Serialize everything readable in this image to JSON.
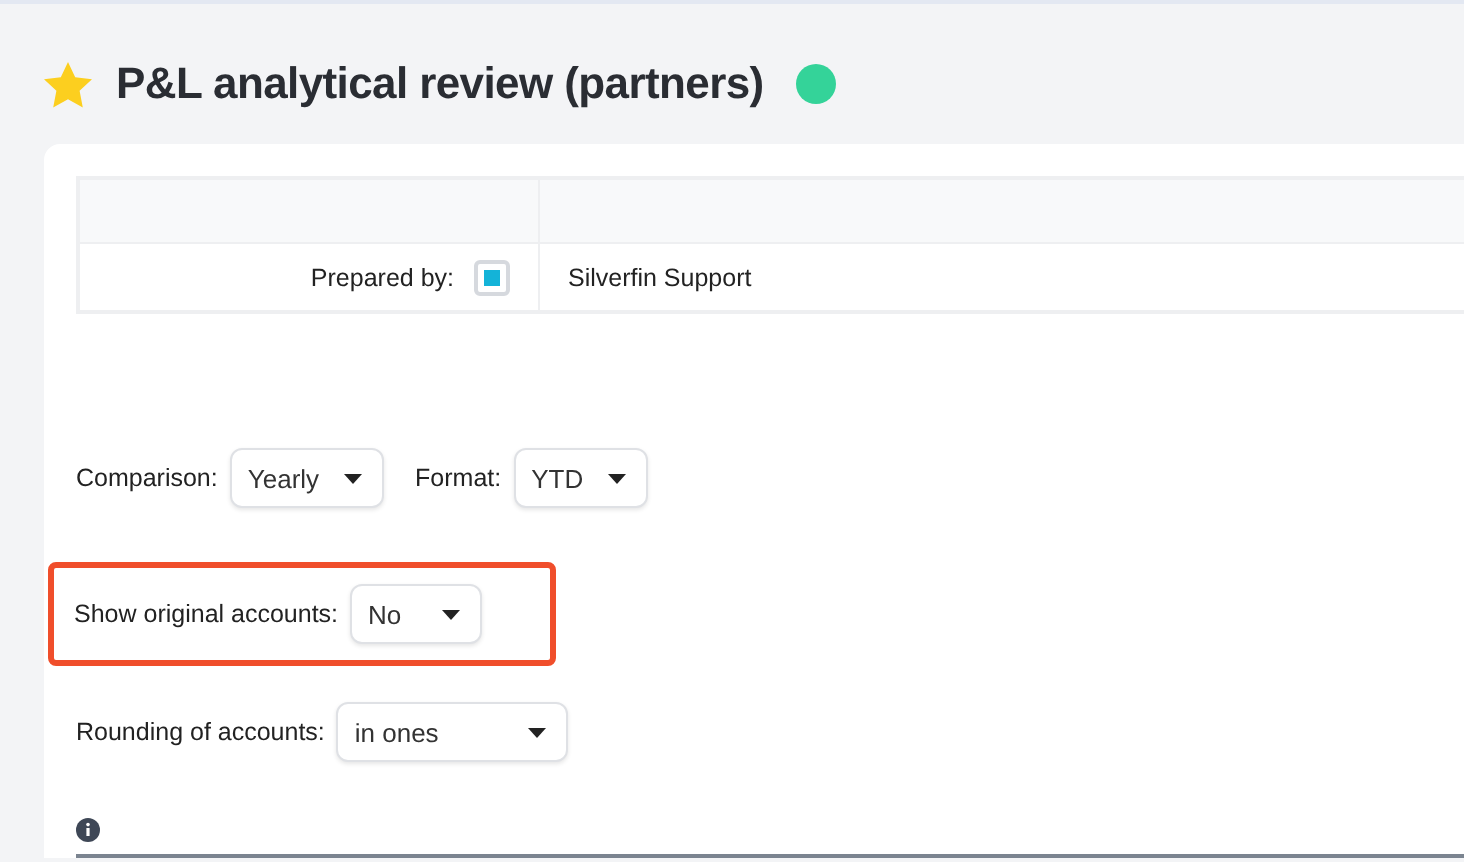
{
  "title": {
    "text": "P&L analytical review (partners)",
    "starred": true,
    "status": {
      "color": "#34d399"
    }
  },
  "table": {
    "rows": [
      {
        "label": "Prepared by:",
        "checked": true,
        "value": "Silverfin Support"
      }
    ]
  },
  "options": [
    {
      "label": "Comparison:",
      "value": "Yearly",
      "highlighted": false
    },
    {
      "label": "Format:",
      "value": "YTD",
      "highlighted": false
    },
    {
      "label": "Show original accounts:",
      "value": "No",
      "highlighted": true
    },
    {
      "label": "Rounding of accounts:",
      "value": "in ones",
      "highlighted": false
    }
  ]
}
